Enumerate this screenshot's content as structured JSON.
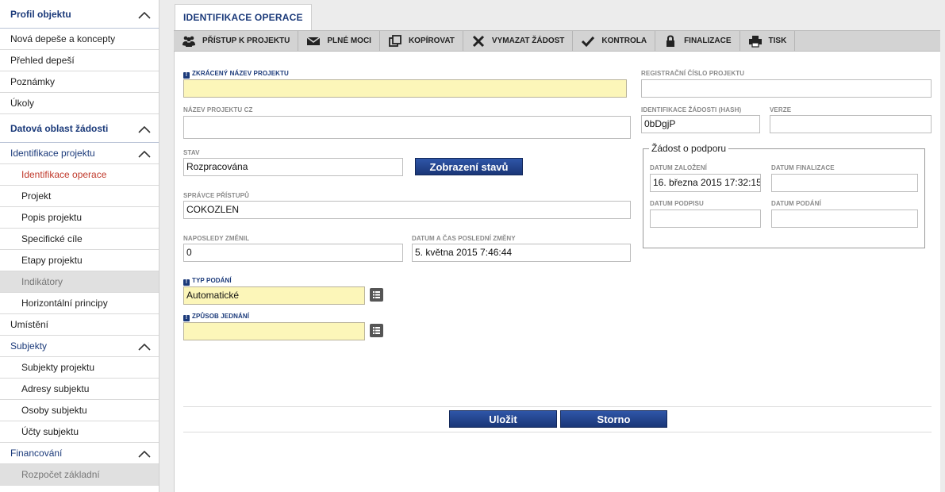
{
  "sidebar": {
    "items": [
      {
        "label": "Profil objektu",
        "kind": "section",
        "chevron": true
      },
      {
        "label": "Nová depeše a koncepty",
        "kind": "item"
      },
      {
        "label": "Přehled depeší",
        "kind": "item"
      },
      {
        "label": "Poznámky",
        "kind": "item"
      },
      {
        "label": "Úkoly",
        "kind": "item"
      },
      {
        "label": "Datová oblast žádosti",
        "kind": "section",
        "chevron": true
      },
      {
        "label": "Identifikace projektu",
        "kind": "group",
        "chevron": true
      },
      {
        "label": "Identifikace operace",
        "kind": "sub-active"
      },
      {
        "label": "Projekt",
        "kind": "sub"
      },
      {
        "label": "Popis projektu",
        "kind": "sub"
      },
      {
        "label": "Specifické cíle",
        "kind": "sub"
      },
      {
        "label": "Etapy projektu",
        "kind": "sub"
      },
      {
        "label": "Indikátory",
        "kind": "sub-disabled"
      },
      {
        "label": "Horizontální principy",
        "kind": "sub"
      },
      {
        "label": "Umístění",
        "kind": "item"
      },
      {
        "label": "Subjekty",
        "kind": "group",
        "chevron": true
      },
      {
        "label": "Subjekty projektu",
        "kind": "sub"
      },
      {
        "label": "Adresy subjektu",
        "kind": "sub"
      },
      {
        "label": "Osoby subjektu",
        "kind": "sub"
      },
      {
        "label": "Účty subjektu",
        "kind": "sub"
      },
      {
        "label": "Financování",
        "kind": "group",
        "chevron": true
      },
      {
        "label": "Rozpočet základní",
        "kind": "sub-disabled"
      }
    ]
  },
  "tab": {
    "label": "IDENTIFIKACE OPERACE"
  },
  "toolbar": {
    "items": [
      {
        "label": "PŘÍSTUP K PROJEKTU",
        "icon": "people-icon"
      },
      {
        "label": "PLNÉ MOCI",
        "icon": "envelope-icon"
      },
      {
        "label": "KOPÍROVAT",
        "icon": "copy-icon"
      },
      {
        "label": "VYMAZAT ŽÁDOST",
        "icon": "x-icon"
      },
      {
        "label": "KONTROLA",
        "icon": "check-icon"
      },
      {
        "label": "FINALIZACE",
        "icon": "lock-icon"
      },
      {
        "label": "TISK",
        "icon": "printer-icon"
      }
    ]
  },
  "form": {
    "short_name_label": "ZKRÁCENÝ NÁZEV PROJEKTU",
    "short_name_value": "",
    "name_cz_label": "NÁZEV PROJEKTU CZ",
    "name_cz_value": "",
    "state_label": "STAV",
    "state_value": "Rozpracována",
    "show_states_button": "Zobrazení stavů",
    "access_admin_label": "SPRÁVCE PŘÍSTUPŮ",
    "access_admin_value": "COKOZLEN",
    "last_changed_by_label": "NAPOSLEDY ZMĚNIL",
    "last_changed_by_value": "0",
    "last_change_label": "DATUM A ČAS POSLEDNÍ ZMĚNY",
    "last_change_value": "5. května 2015 7:46:44",
    "submission_type_label": "TYP PODÁNÍ",
    "submission_type_value": "Automatické",
    "negotiation_label": "ZPŮSOB JEDNÁNÍ",
    "negotiation_value": "",
    "reg_number_label": "REGISTRAČNÍ ČÍSLO PROJEKTU",
    "reg_number_value": "",
    "hash_label": "IDENTIFIKACE ŽÁDOSTI (HASH)",
    "hash_value": "0bDgjP",
    "version_label": "VERZE",
    "version_value": ""
  },
  "support": {
    "legend": "Žádost o podporu",
    "created_label": "DATUM ZALOŽENÍ",
    "created_value": "16. března 2015 17:32:15",
    "finalized_label": "DATUM FINALIZACE",
    "finalized_value": "",
    "signed_label": "DATUM PODPISU",
    "signed_value": "",
    "submitted_label": "DATUM PODÁNÍ",
    "submitted_value": ""
  },
  "actions": {
    "save": "Uložit",
    "cancel": "Storno"
  },
  "colors": {
    "accent": "#1b3a7a",
    "required_bg": "#fcf6b9",
    "active_link": "#c0392b"
  }
}
